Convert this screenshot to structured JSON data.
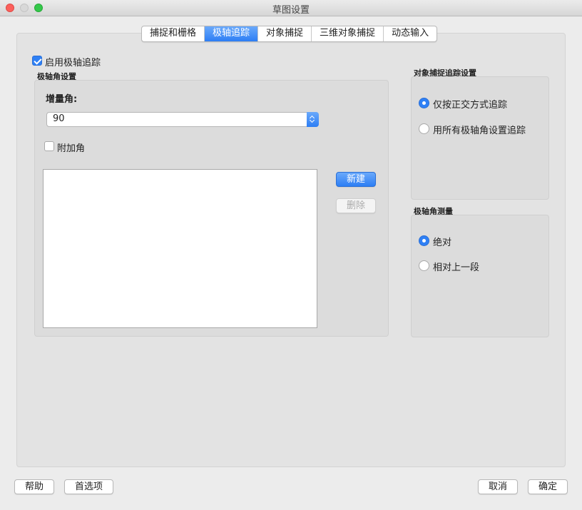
{
  "window": {
    "title": "草图设置"
  },
  "tabs": [
    {
      "label": "捕捉和栅格",
      "active": false
    },
    {
      "label": "极轴追踪",
      "active": true
    },
    {
      "label": "对象捕捉",
      "active": false
    },
    {
      "label": "三维对象捕捉",
      "active": false
    },
    {
      "label": "动态输入",
      "active": false
    }
  ],
  "polar": {
    "enable_label": "启用极轴追踪",
    "enabled": true,
    "angle_group_title": "极轴角设置",
    "increment_label": "增量角:",
    "increment_value": "90",
    "additional_label": "附加角",
    "additional_checked": false,
    "additional_angles": [],
    "new_button": "新建",
    "delete_button": "删除"
  },
  "object_snap_tracking": {
    "title": "对象捕捉追踪设置",
    "options": [
      {
        "label": "仅按正交方式追踪",
        "selected": true
      },
      {
        "label": "用所有极轴角设置追踪",
        "selected": false
      }
    ]
  },
  "polar_measurement": {
    "title": "极轴角测量",
    "options": [
      {
        "label": "绝对",
        "selected": true
      },
      {
        "label": "相对上一段",
        "selected": false
      }
    ]
  },
  "footer": {
    "help": "帮助",
    "preferences": "首选项",
    "cancel": "取消",
    "ok": "确定"
  },
  "colors": {
    "accent": "#2f80f5",
    "panel": "#e3e3e3",
    "window": "#ececec"
  }
}
